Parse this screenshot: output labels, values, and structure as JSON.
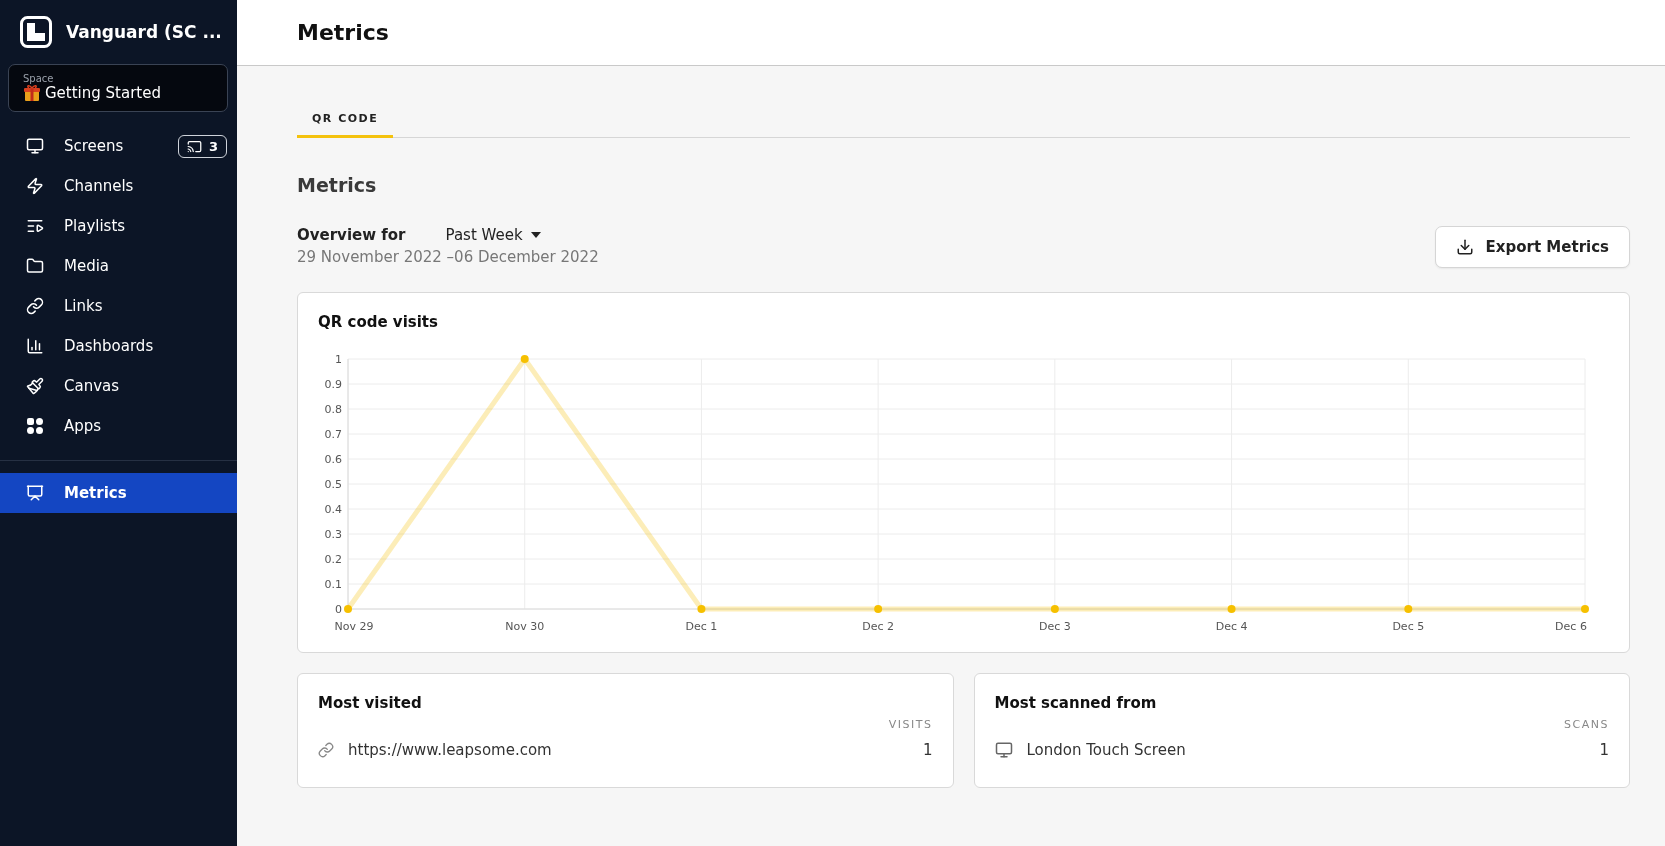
{
  "sidebar": {
    "workspace": "Vanguard (SC ...",
    "space": {
      "label": "Space",
      "name": "Getting Started"
    },
    "items": [
      {
        "label": "Screens",
        "selected": false,
        "badge": "3"
      },
      {
        "label": "Channels",
        "selected": false
      },
      {
        "label": "Playlists",
        "selected": false
      },
      {
        "label": "Media",
        "selected": false
      },
      {
        "label": "Links",
        "selected": false
      },
      {
        "label": "Dashboards",
        "selected": false
      },
      {
        "label": "Canvas",
        "selected": false
      },
      {
        "label": "Apps",
        "selected": false
      }
    ],
    "secondary_items": [
      {
        "label": "Metrics",
        "selected": true
      }
    ]
  },
  "header": {
    "title": "Metrics"
  },
  "tabs": [
    {
      "label": "QR CODE",
      "selected": true
    }
  ],
  "section_title": "Metrics",
  "overview": {
    "label": "Overview for",
    "period": "Past Week",
    "range": "29 November 2022 –06 December 2022"
  },
  "export_button": "Export Metrics",
  "chart_card": {
    "title": "QR code visits",
    "chart_data": {
      "type": "line",
      "categories": [
        "Nov 29",
        "Nov 30",
        "Dec 1",
        "Dec 2",
        "Dec 3",
        "Dec 4",
        "Dec 5",
        "Dec 6"
      ],
      "series": [
        {
          "color": "#f6c000",
          "values": [
            0,
            1,
            0,
            0,
            0,
            0,
            0,
            0
          ]
        }
      ],
      "grid": true,
      "marker": true,
      "ylim": [
        0,
        1
      ],
      "yticks": [
        0,
        0.1,
        0.2,
        0.3,
        0.4,
        0.5,
        0.6,
        0.7,
        0.8,
        0.9,
        1
      ]
    }
  },
  "lists": [
    {
      "title": "Most visited",
      "column": "VISITS",
      "rows": [
        {
          "name": "https://www.leapsome.com",
          "count": "1"
        }
      ]
    },
    {
      "title": "Most scanned from",
      "column": "SCANS",
      "rows": [
        {
          "name": "London Touch Screen",
          "count": "1"
        }
      ]
    }
  ]
}
